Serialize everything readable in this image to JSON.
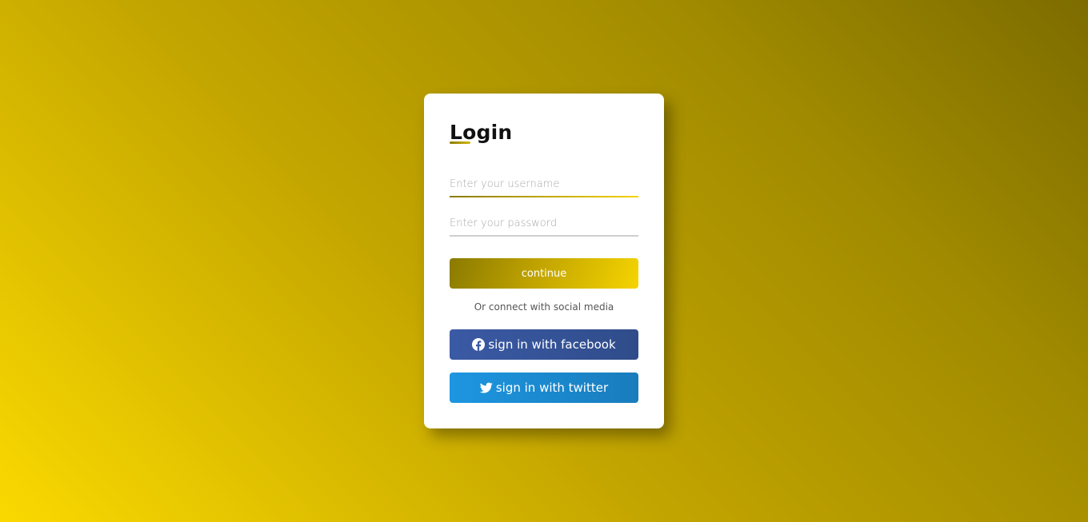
{
  "login": {
    "title": "Login",
    "username": {
      "placeholder": "Enter your username",
      "value": ""
    },
    "password": {
      "placeholder": "Enter your password",
      "value": ""
    },
    "continue_label": "continue",
    "social_text": "Or connect with social media",
    "facebook_label": "sign in with facebook",
    "twitter_label": "sign in with twitter"
  },
  "icons": {
    "facebook": "facebook-icon",
    "twitter": "twitter-icon"
  },
  "colors": {
    "background_start": "#fad900",
    "background_end": "#7d6c00",
    "accent": "#c0a300",
    "facebook": "#3b5aa5",
    "twitter": "#1d96e0"
  }
}
